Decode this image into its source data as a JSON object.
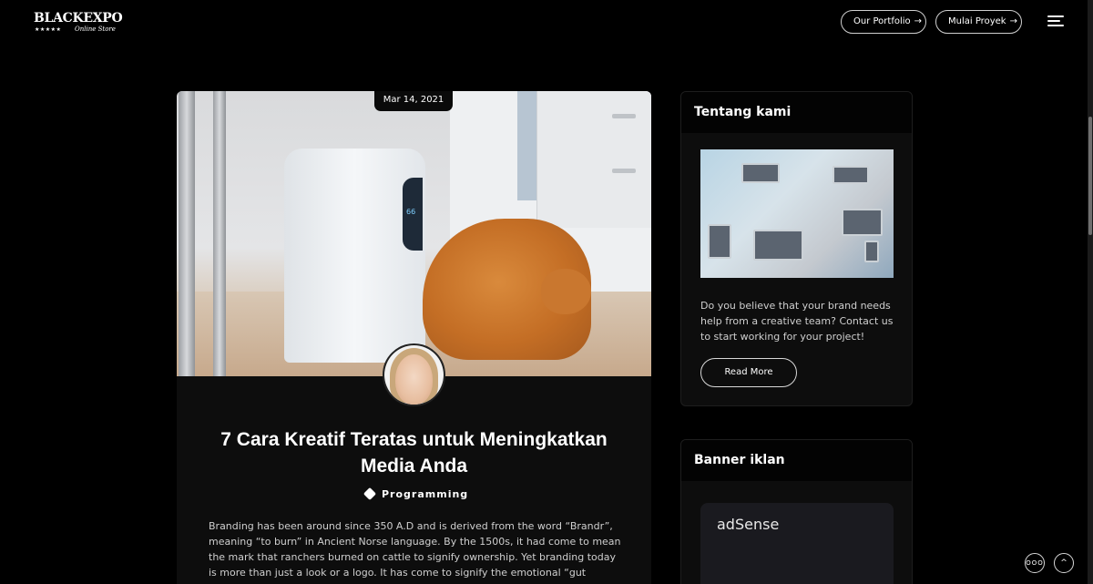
{
  "header": {
    "logo_main": "BLACKEXPO",
    "logo_stars": "★★★★★",
    "logo_sub": "Online Store",
    "btn_portfolio": "Our Portfolio",
    "btn_proyek": "Mulai Proyek",
    "arrow": "→"
  },
  "post": {
    "date": "Mar 14, 2021",
    "title": "7 Cara Kreatif Teratas untuk Meningkatkan Media Anda",
    "tag": "Programming",
    "excerpt": "Branding has been around since 350 A.D and is derived from the word “Brandr”, meaning “to burn” in Ancient Norse language. By the 1500s, it had come to mean the mark that ranchers burned on cattle to signify ownership. Yet branding today is more than just a look or a logo. It has come to signify the emotional “gut feeling” reaction ...",
    "device_reading": "66"
  },
  "sidebar": {
    "about_title": "Tentang kami",
    "about_text": "Do you believe that your brand needs help from a creative team? Contact us to start working for your project!",
    "read_more": "Read More",
    "banner_title": "Banner iklan",
    "adsense": "adSense"
  },
  "floating": {
    "chat": "OOO",
    "top": "^"
  },
  "icons": {
    "menu": "hamburger-menu-icon",
    "tag": "tag-icon",
    "chat": "chat-bubble-icon",
    "scroll_top": "chevron-up-icon"
  },
  "colors": {
    "background": "#000000",
    "card": "#0d0d0d",
    "text": "#ffffff",
    "muted_text": "#cfcfcf"
  }
}
